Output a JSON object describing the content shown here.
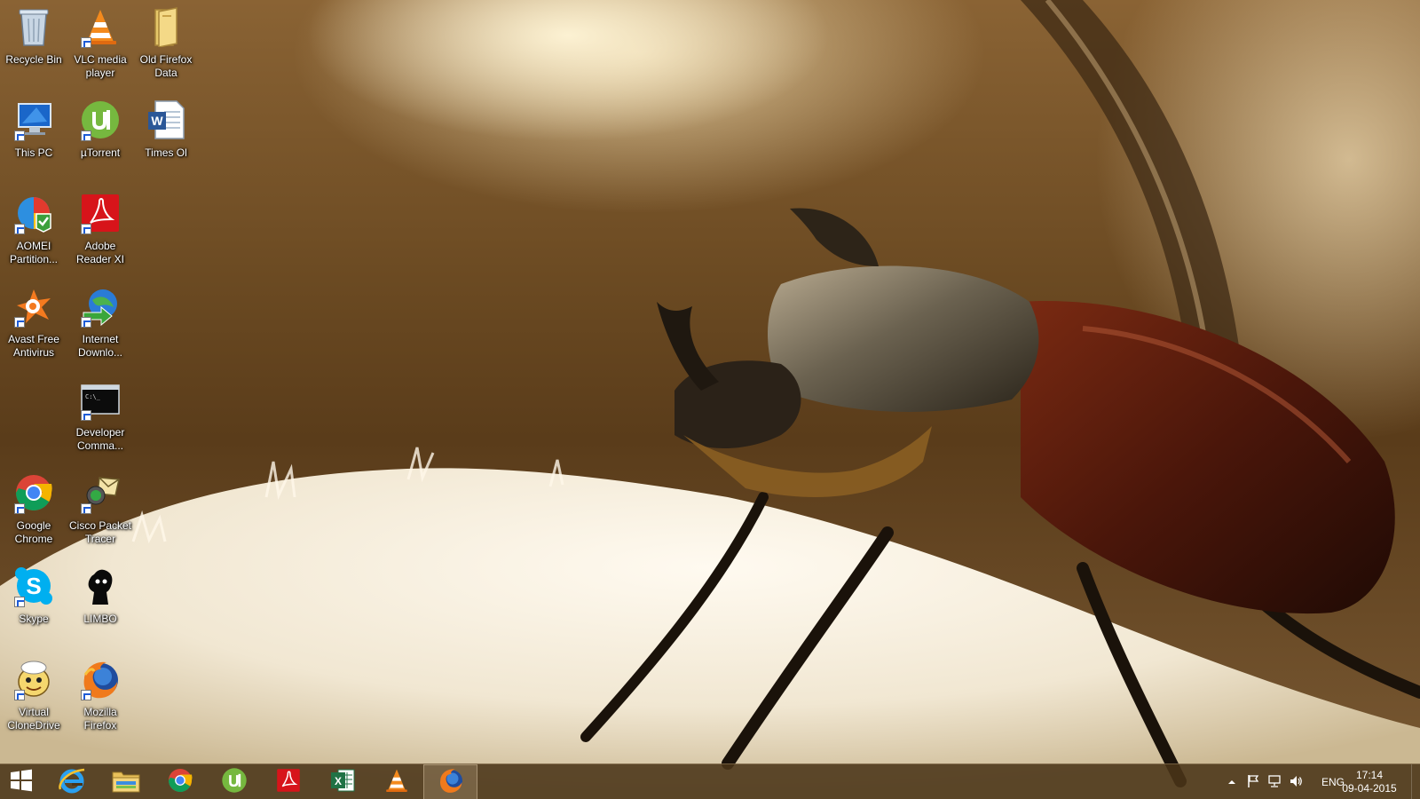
{
  "desktop": {
    "icons": [
      {
        "label": "Recycle Bin",
        "icon": "recycle-bin-icon"
      },
      {
        "label": "VLC media player",
        "icon": "vlc-icon"
      },
      {
        "label": "Old Firefox Data",
        "icon": "folder-icon"
      },
      {
        "label": "This PC",
        "icon": "computer-icon"
      },
      {
        "label": "µTorrent",
        "icon": "utorrent-icon"
      },
      {
        "label": "Times Ol",
        "icon": "word-document-icon"
      },
      {
        "label": "AOMEI Partition...",
        "icon": "aomei-icon"
      },
      {
        "label": "Adobe Reader XI",
        "icon": "adobe-reader-icon"
      },
      {
        "label": "Avast Free Antivirus",
        "icon": "avast-icon"
      },
      {
        "label": "Internet Downlo...",
        "icon": "idm-icon"
      },
      {
        "label": "Developer Comma...",
        "icon": "command-prompt-icon"
      },
      {
        "label": "Google Chrome",
        "icon": "chrome-icon"
      },
      {
        "label": "Cisco Packet Tracer",
        "icon": "packet-tracer-icon"
      },
      {
        "label": "Skype",
        "icon": "skype-icon"
      },
      {
        "label": "LIMBO",
        "icon": "limbo-icon"
      },
      {
        "label": "Virtual CloneDrive",
        "icon": "clonedrive-icon"
      },
      {
        "label": "Mozilla Firefox",
        "icon": "firefox-icon"
      }
    ]
  },
  "taskbar": {
    "pinned": [
      {
        "icon": "windows-start-icon"
      },
      {
        "icon": "internet-explorer-icon"
      },
      {
        "icon": "file-explorer-icon"
      },
      {
        "icon": "chrome-icon"
      },
      {
        "icon": "utorrent-icon"
      },
      {
        "icon": "adobe-reader-icon"
      },
      {
        "icon": "excel-icon"
      },
      {
        "icon": "vlc-icon"
      },
      {
        "icon": "firefox-icon",
        "active": true
      }
    ],
    "tray": {
      "language": "ENG",
      "time": "17:14",
      "date": "09-04-2015"
    }
  },
  "colors": {
    "taskbar": "#4a3418",
    "icon_label": "#ffffff"
  }
}
